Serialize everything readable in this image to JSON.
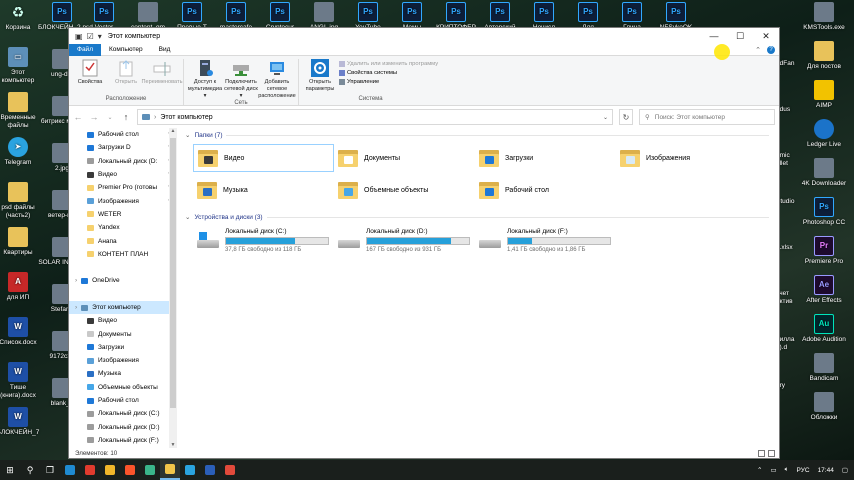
{
  "desktop": {
    "left_icons": [
      {
        "label": "Корзина",
        "type": "bin"
      },
      {
        "label": "Этот компьютер",
        "type": "pc"
      },
      {
        "label": "Временные файлы",
        "type": "folder"
      },
      {
        "label": "Telegram",
        "type": "tg"
      },
      {
        "label": "psd файлы (часть2)",
        "type": "folder"
      },
      {
        "label": "Квартиры",
        "type": "folder"
      },
      {
        "label": "для ИП",
        "type": "pdf"
      },
      {
        "label": "Список.docx",
        "type": "word"
      },
      {
        "label": "Тише (книга).docx",
        "type": "word"
      },
      {
        "label": "БЛОКЧЕЙН_7",
        "type": "word"
      }
    ],
    "col2_icons": [
      {
        "label": "БЛОКЧЕЙН_2.psd",
        "type": "ps"
      },
      {
        "label": "ung-dut",
        "type": "misc"
      },
      {
        "label": "битрикс мес...",
        "type": "misc"
      },
      {
        "label": "2.jpg",
        "type": "misc"
      },
      {
        "label": "ветер-в...",
        "type": "misc"
      },
      {
        "label": "SOLAR INVEST",
        "type": "misc"
      },
      {
        "label": "Stefan_",
        "type": "misc"
      },
      {
        "label": "9172c33",
        "type": "misc"
      },
      {
        "label": "blank_7",
        "type": "misc"
      }
    ],
    "top_icons": [
      {
        "label": "Vector",
        "type": "ps"
      },
      {
        "label": "content_gm",
        "type": "misc"
      },
      {
        "label": "Превью-Т",
        "type": "ps"
      },
      {
        "label": "mastercafe",
        "type": "ps"
      },
      {
        "label": "Cryptocur",
        "type": "ps"
      },
      {
        "label": "ANGL.jpg",
        "type": "misc"
      },
      {
        "label": "YouTube",
        "type": "ps"
      },
      {
        "label": "Мемы",
        "type": "ps"
      },
      {
        "label": "КРИПТОФЕР",
        "type": "ps"
      },
      {
        "label": "Авторский",
        "type": "ps"
      },
      {
        "label": "Нечисл",
        "type": "ps"
      },
      {
        "label": "Для",
        "type": "ps"
      },
      {
        "label": "Глина",
        "type": "ps"
      },
      {
        "label": "NFSvkoOK",
        "type": "ps"
      }
    ],
    "right_icons": [
      {
        "label": "KMSTools.exe",
        "type": "misc"
      },
      {
        "label": "Для постов",
        "type": "folder"
      },
      {
        "label": "AIMP",
        "type": "yellow"
      },
      {
        "label": "Ledger Live",
        "type": "blue"
      },
      {
        "label": "4K Downloader",
        "type": "misc"
      },
      {
        "label": "Photoshop CC",
        "type": "ps"
      },
      {
        "label": "Premiere Pro",
        "type": "pr"
      },
      {
        "label": "After Effects",
        "type": "ae"
      },
      {
        "label": "Adobe Audition",
        "type": "au"
      },
      {
        "label": "Bandicam",
        "type": "misc"
      },
      {
        "label": "Обложки",
        "type": "misc"
      }
    ],
    "right_partial": [
      "edFan",
      "odus",
      "omic allet",
      "Studio",
      "o.xlsx",
      "учет ектив",
      "рилла я).d",
      "ory"
    ]
  },
  "window": {
    "title": "Этот компьютер",
    "quick_access": [
      "▣",
      "☑",
      "▾"
    ],
    "controls": {
      "minimize": "—",
      "maximize": "☐",
      "close": "✕"
    },
    "tabs": [
      {
        "label": "Файл"
      },
      {
        "label": "Компьютер"
      },
      {
        "label": "Вид"
      }
    ],
    "ribbon": {
      "group1": {
        "name": "Расположение",
        "buttons": [
          {
            "label": "Свойства",
            "enabled": true
          },
          {
            "label": "Открыть",
            "enabled": false
          },
          {
            "label": "Переименовать",
            "enabled": false
          }
        ]
      },
      "group2": {
        "name": "Сеть",
        "buttons": [
          {
            "label": "Доступ к мультимедиа ▾"
          },
          {
            "label": "Подключить сетевой диск ▾"
          },
          {
            "label": "Добавить сетевое расположение"
          }
        ]
      },
      "group3": {
        "name": "Система",
        "open_params": "Открыть параметры",
        "small": [
          {
            "label": "Удалить или изменить программу",
            "enabled": false
          },
          {
            "label": "Свойства системы",
            "enabled": true
          },
          {
            "label": "Управление",
            "enabled": true
          }
        ]
      }
    },
    "address": {
      "path": "Этот компьютер",
      "search_placeholder": "Поиск: Этот компьютер"
    },
    "nav_pane": [
      {
        "label": "Рабочий стол",
        "pinned": true,
        "icon": "desktop",
        "top": false
      },
      {
        "label": "Загрузки D",
        "pinned": true,
        "icon": "download",
        "top": false
      },
      {
        "label": "Локальный диск (D:",
        "pinned": true,
        "icon": "drive",
        "top": false
      },
      {
        "label": "Видео",
        "pinned": true,
        "icon": "video",
        "top": false
      },
      {
        "label": "Premier Pro (готовы",
        "pinned": true,
        "icon": "folder",
        "top": false
      },
      {
        "label": "Изображения",
        "pinned": true,
        "icon": "pictures",
        "top": false
      },
      {
        "label": "WETER",
        "pinned": false,
        "icon": "folder",
        "top": false
      },
      {
        "label": "Yandex",
        "pinned": false,
        "icon": "folder",
        "top": false
      },
      {
        "label": "Анапа",
        "pinned": false,
        "icon": "folder",
        "top": false
      },
      {
        "label": "КОНТЕНТ ПЛАН",
        "pinned": false,
        "icon": "folder",
        "top": false
      },
      {
        "label": "",
        "pinned": false,
        "icon": "",
        "top": false
      },
      {
        "label": "OneDrive",
        "pinned": false,
        "icon": "cloud",
        "top": true
      },
      {
        "label": "",
        "pinned": false,
        "icon": "",
        "top": false
      },
      {
        "label": "Этот компьютер",
        "pinned": false,
        "icon": "pc",
        "top": true,
        "selected": true
      },
      {
        "label": "Видео",
        "pinned": false,
        "icon": "video",
        "top": false
      },
      {
        "label": "Документы",
        "pinned": false,
        "icon": "docs",
        "top": false
      },
      {
        "label": "Загрузки",
        "pinned": false,
        "icon": "download",
        "top": false
      },
      {
        "label": "Изображения",
        "pinned": false,
        "icon": "pictures",
        "top": false
      },
      {
        "label": "Музыка",
        "pinned": false,
        "icon": "music",
        "top": false
      },
      {
        "label": "Объемные объекты",
        "pinned": false,
        "icon": "3d",
        "top": false
      },
      {
        "label": "Рабочий стол",
        "pinned": false,
        "icon": "desktop",
        "top": false
      },
      {
        "label": "Локальный диск (C:)",
        "pinned": false,
        "icon": "drive",
        "top": false
      },
      {
        "label": "Локальный диск (D:)",
        "pinned": false,
        "icon": "drive",
        "top": false
      },
      {
        "label": "Локальный диск (F:)",
        "pinned": false,
        "icon": "drive",
        "top": false
      },
      {
        "label": "",
        "pinned": false,
        "icon": "",
        "top": false
      },
      {
        "label": "Локальный диск (F:)",
        "pinned": false,
        "icon": "drive",
        "top": true
      }
    ],
    "folders_header": "Папки (7)",
    "folders": [
      {
        "label": "Видео",
        "glyph_color": "#3a3a3a",
        "selected": true
      },
      {
        "label": "Документы",
        "glyph_color": "#ffffff",
        "selected": false
      },
      {
        "label": "Загрузки",
        "glyph_color": "#1e78d7",
        "selected": false
      },
      {
        "label": "Изображения",
        "glyph_color": "#d8eaf6",
        "selected": false
      },
      {
        "label": "Музыка",
        "glyph_color": "#2a6fc4",
        "selected": false
      },
      {
        "label": "Объемные объекты",
        "glyph_color": "#46a7e8",
        "selected": false
      },
      {
        "label": "Рабочий стол",
        "glyph_color": "#1e78d7",
        "selected": false
      }
    ],
    "drives_header": "Устройства и диски (3)",
    "drives": [
      {
        "label": "Локальный диск (C:)",
        "free": "37,8 ГБ свободно из 118 ГБ",
        "used_fraction": 0.68,
        "system": true
      },
      {
        "label": "Локальный диск (D:)",
        "free": "167 ГБ свободно из 931 ГБ",
        "used_fraction": 0.82,
        "system": false
      },
      {
        "label": "Локальный диск (F:)",
        "free": "1,41 ГБ свободно из 1,86 ГБ",
        "used_fraction": 0.24,
        "system": false
      }
    ],
    "status": "Элементов: 10"
  },
  "taskbar": {
    "apps": [
      {
        "name": "start-button",
        "glyph": "⊞",
        "color": "#ffffff"
      },
      {
        "name": "search",
        "glyph": "⚲",
        "color": "#ffffff"
      },
      {
        "name": "task-view",
        "glyph": "❐",
        "color": "#ffffff"
      },
      {
        "name": "edge",
        "glyph": "",
        "color": "#1f8ad2"
      },
      {
        "name": "yandex",
        "glyph": "",
        "color": "#e23b2e"
      },
      {
        "name": "chrome",
        "glyph": "",
        "color": "#f1b52a"
      },
      {
        "name": "brave",
        "glyph": "",
        "color": "#fb542b"
      },
      {
        "name": "app-green",
        "glyph": "",
        "color": "#3ab48a"
      },
      {
        "name": "explorer",
        "glyph": "",
        "color": "#f3c54a"
      },
      {
        "name": "telegram",
        "glyph": "",
        "color": "#2aa3e0"
      },
      {
        "name": "word",
        "glyph": "",
        "color": "#2b5fb9"
      },
      {
        "name": "bandicam",
        "glyph": "",
        "color": "#e24a3b"
      }
    ],
    "lang": "РУС",
    "time": "17:44"
  },
  "colors": {
    "accent": "#1979ca",
    "drive_fill": "#26a0da",
    "cursor_highlight": "#ffe600"
  }
}
